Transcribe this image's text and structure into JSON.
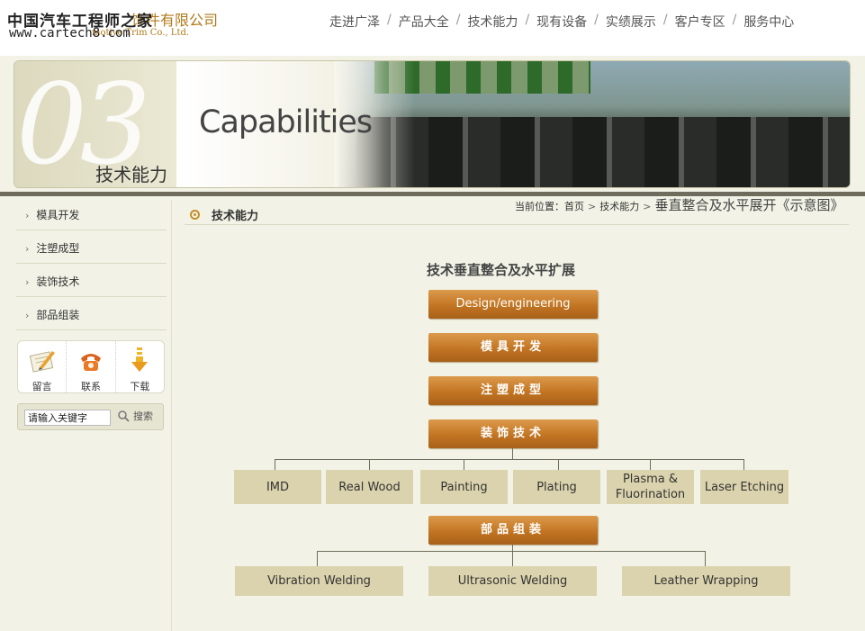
{
  "header": {
    "logo_cn_overlay": "中国汽车工程师之家",
    "logo_cn_company": "饰件有限公司",
    "logo_en": "motive Trim Co., Ltd.",
    "logo_url": "www.cartech8.com",
    "nav": [
      "走进广泽",
      "产品大全",
      "技术能力",
      "现有设备",
      "实绩展示",
      "客户专区",
      "服务中心"
    ]
  },
  "banner": {
    "number": "03",
    "title_cn": "技术能力",
    "title_en": "Capabilities"
  },
  "sidebar": {
    "items": [
      "模具开发",
      "注塑成型",
      "装饰技术",
      "部品组装"
    ],
    "quick_links": [
      "留言",
      "联系",
      "下载"
    ],
    "search": {
      "value": "请输入关键字",
      "button": "搜索"
    }
  },
  "main": {
    "title": "技术能力",
    "breadcrumb": {
      "prefix": "当前位置：",
      "home": "首页",
      "section": "技术能力",
      "current": "垂直整合及水平展开《示意图》"
    }
  },
  "diagram": {
    "title": "技术垂直整合及水平扩展",
    "stages": [
      "Design/engineering",
      "模具开发",
      "注塑成型",
      "装饰技术"
    ],
    "decoration_techniques": [
      "IMD",
      "Real Wood",
      "Painting",
      "Plating",
      "Plasma & Fluorination",
      "Laser Etching"
    ],
    "assembly": "部品组装",
    "assembly_techniques": [
      "Vibration Welding",
      "Ultrasonic Welding",
      "Leather Wrapping"
    ]
  },
  "colors": {
    "accent_orange": "#c27522",
    "box_beige": "#dbd3ad",
    "background": "#f2f3e6"
  }
}
